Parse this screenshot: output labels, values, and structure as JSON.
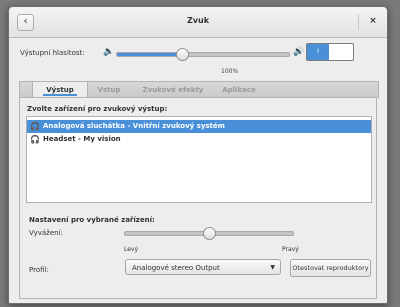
{
  "window": {
    "title": "Zvuk",
    "back_icon": "chevron-left-icon",
    "close_icon": "close-icon"
  },
  "volume": {
    "label": "Výstupní hlasitost:",
    "percent_label": "100%",
    "level": 0.38,
    "mute_toggle_on_label": "I",
    "mute_toggle_on": true
  },
  "tabs": [
    {
      "label": "Výstup",
      "active": true
    },
    {
      "label": "Vstup",
      "active": false
    },
    {
      "label": "Zvukové efekty",
      "active": false
    },
    {
      "label": "Aplikace",
      "active": false
    }
  ],
  "output": {
    "choose_label": "Zvolte zařízení pro zvukový výstup:",
    "devices": [
      {
        "label": "Analogová sluchátka - Vnitřní zvukový systém",
        "icon": "headphones-icon",
        "selected": true
      },
      {
        "label": "Headset - My vision",
        "icon": "headphones-icon",
        "selected": false
      }
    ]
  },
  "settings": {
    "title": "Nastavení pro vybrané zařízení:",
    "balance_label": "Vyvážení:",
    "balance_left": "Levý",
    "balance_right": "Pravý",
    "balance_value": 0.5,
    "profile_label": "Profil:",
    "profile_value": "Analogové stereo Output",
    "test_button": "Otestovat reproduktory"
  },
  "colors": {
    "accent": "#4a90d9",
    "background": "#ededed"
  }
}
